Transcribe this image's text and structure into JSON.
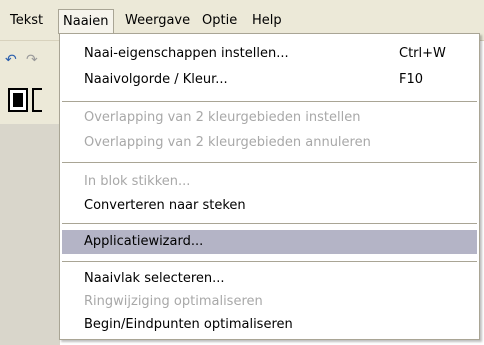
{
  "menubar": {
    "items": [
      {
        "label": "Tekst"
      },
      {
        "label": "Naaien"
      },
      {
        "label": "Weergave"
      },
      {
        "label": "Optie"
      },
      {
        "label": "Help"
      }
    ]
  },
  "toolbar": {
    "undo_icon": "undo-icon",
    "redo_icon": "redo-icon"
  },
  "menu": {
    "items": [
      {
        "label": "Naai-eigenschappen instellen...",
        "shortcut": "Ctrl+W",
        "enabled": true
      },
      {
        "label": "Naaivolgorde / Kleur...",
        "shortcut": "F10",
        "enabled": true
      },
      {
        "label": "Overlapping van 2 kleurgebieden instellen",
        "enabled": false
      },
      {
        "label": "Overlapping van 2 kleurgebieden annuleren",
        "enabled": false
      },
      {
        "label": "In blok stikken...",
        "enabled": false
      },
      {
        "label": "Converteren naar steken",
        "enabled": true
      },
      {
        "label": "Applicatiewizard...",
        "enabled": true,
        "highlighted": true
      },
      {
        "label": "Naaivlak selecteren...",
        "enabled": true
      },
      {
        "label": "Ringwijziging optimaliseren",
        "enabled": false
      },
      {
        "label": "Begin/Eindpunten optimaliseren",
        "enabled": true
      }
    ]
  },
  "colors": {
    "highlight": "#b4b4c6",
    "disabled_text": "#a8a8a8",
    "menubar_bg": "#ece9d8"
  }
}
